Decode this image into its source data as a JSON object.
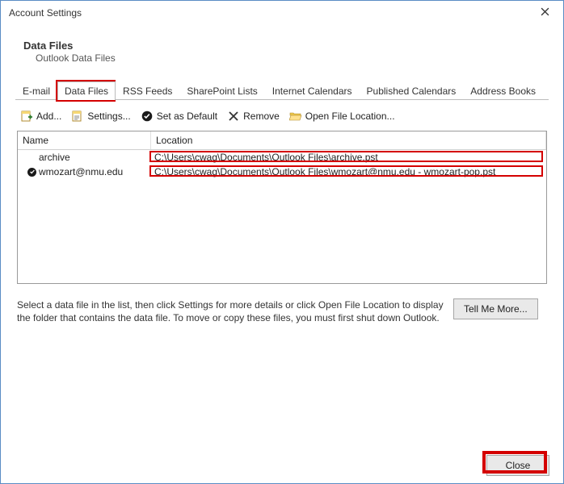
{
  "window": {
    "title": "Account Settings"
  },
  "heading": {
    "main": "Data Files",
    "sub": "Outlook Data Files"
  },
  "tabs": [
    "E-mail",
    "Data Files",
    "RSS Feeds",
    "SharePoint Lists",
    "Internet Calendars",
    "Published Calendars",
    "Address Books"
  ],
  "active_tab_index": 1,
  "toolbar": {
    "add": "Add...",
    "settings": "Settings...",
    "set_default": "Set as Default",
    "remove": "Remove",
    "open_location": "Open File Location..."
  },
  "list": {
    "columns": {
      "name": "Name",
      "location": "Location"
    },
    "rows": [
      {
        "name": "archive",
        "is_default": false,
        "location": "C:\\Users\\cwag\\Documents\\Outlook Files\\archive.pst"
      },
      {
        "name": "wmozart@nmu.edu",
        "is_default": true,
        "location": "C:\\Users\\cwag\\Documents\\Outlook Files\\wmozart@nmu.edu - wmozart-pop.pst"
      }
    ]
  },
  "hint": "Select a data file in the list, then click Settings for more details or click Open File Location to display the folder that contains the data file. To move or copy these files, you must first shut down Outlook.",
  "buttons": {
    "tell_me_more": "Tell Me More...",
    "close": "Close"
  }
}
